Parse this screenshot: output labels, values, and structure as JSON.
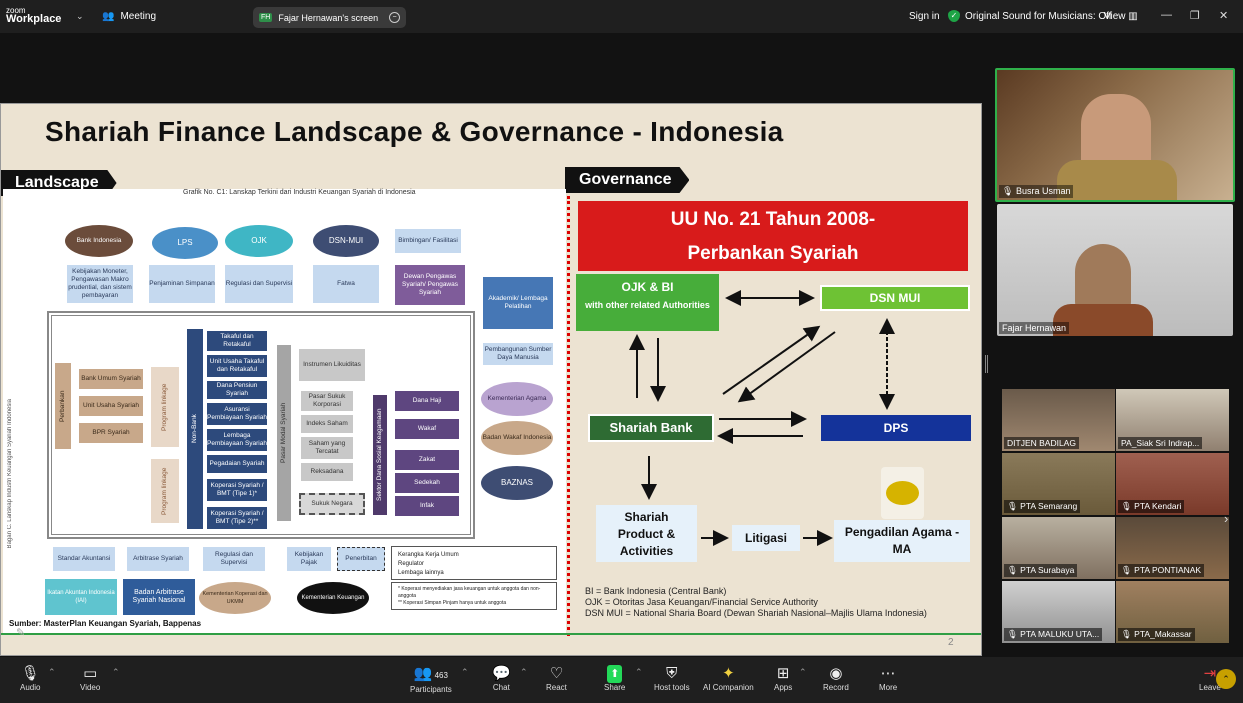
{
  "topbar": {
    "logo_line1": "zoom",
    "logo_line2": "Workplace",
    "meeting_label": "Meeting",
    "screen_share_initials": "FH",
    "screen_share_label": "Fajar Hernawan's screen",
    "sign_in": "Sign in",
    "sound_label": "Original Sound for Musicians: Off",
    "view_label": "View"
  },
  "slide": {
    "title": "Shariah Finance Landscape & Governance - Indonesia",
    "landscape_tag": "Landscape",
    "governance_tag": "Governance",
    "landscape": {
      "caption": "Grafik No. C1: Lanskap Terkini dari Industri Keuangan Syariah di Indonesia",
      "side_label": "Bagan C. Lanskap Industri Keuangan Syariah Indonesia",
      "source": "Sumber: MasterPlan Keuangan Syariah, Bappenas",
      "bank_indonesia": "Bank Indonesia",
      "lps": "LPS",
      "ojk": "OJK",
      "dsn_mui": "DSN-MUI",
      "bimbingan": "Bimbingan/ Fasilitasi",
      "kebijakan_moneter": "Kebijakan Moneter, Pengawasan Makro prudential, dan sistem pembayaran",
      "penjaminan": "Penjaminan Simpanan",
      "regulasi_supervisi": "Regulasi dan Supervisi",
      "fatwa": "Fatwa",
      "dewan_pengawas": "Dewan Pengawas Syariah/ Pengawas Syariah",
      "akademik": "Akademik/ Lembaga Pelatihan",
      "pembangunan_sdm": "Pembangunan Sumber Daya Manusia",
      "kementerian_agama": "Kementerian Agama",
      "badan_wakaf": "Badan Wakaf Indonesia",
      "baznas": "BAZNAS",
      "perbankan": "Perbankan",
      "bank_umum": "Bank Umum Syariah",
      "unit_usaha": "Unit Usaha Syariah",
      "bpr": "BPR Syariah",
      "program_linkage_1": "Program linkage",
      "program_linkage_2": "Program linkage",
      "non_bank": "Non-Bank",
      "takaful": "Takaful dan Retakaful",
      "unit_usaha_takaful": "Unit Usaha Takaful dan Retakaful",
      "dana_pensiun": "Dana Pensiun Syariah",
      "asuransi_pembiayaan": "Asuransi Pembiayaan Syariah",
      "lembaga_pembiayaan": "Lembaga Pembiayaan Syariah",
      "pegadaian": "Pegadaian Syariah",
      "koperasi_1": "Koperasi Syariah / BMT (Tipe 1)*",
      "koperasi_2": "Koperasi Syariah / BMT (Tipe 2)**",
      "pasar_modal": "Pasar Modal Syariah",
      "instrumen": "Instrumen Likuiditas",
      "dana_haji": "Dana Haji",
      "wakaf": "Wakaf",
      "zakat": "Zakat",
      "sedekah": "Sedekah",
      "infak": "Infak",
      "sektor_sosial": "Sektor Dana Sosial Keagamaan",
      "pasar_sukuk": "Pasar Sukuk Korporasi",
      "reksa_syariah": "Indeks Saham",
      "saham": "Saham yang Tercatat",
      "reksadana": "Reksadana",
      "sukuk_negara": "Sukuk Negara",
      "standar_akuntansi": "Standar Akuntansi",
      "arbitrase": "Arbitrase Syariah",
      "regulasi_supervisi_2": "Regulasi dan Supervisi",
      "kebijakan_pajak": "Kebijakan Pajak",
      "penerbitan": "Penerbitan",
      "ikatan_akuntan": "Ikatan Akuntan Indonesia (IAI)",
      "basyarnas": "Badan Arbitrase Syariah Nasional",
      "kemenkop": "Kementerian Koperasi dan UKMM",
      "kemenkeu": "Kementerian Keuangan",
      "legend_1": "Kerangka Kerja Umum",
      "legend_2": "Regulator",
      "legend_3": "Lembaga lainnya",
      "legend_note_1": "* Koperasi menyediakan jasa keuangan untuk anggota dan non-anggota",
      "legend_note_2": "** Koperasi Simpan Pinjam hanya untuk anggota"
    },
    "governance": {
      "uu_line1": "UU No. 21 Tahun 2008-",
      "uu_line2": "Perbankan Syariah",
      "ojk_bi": "OJK & BI",
      "ojk_bi_sub": "with other related Authorities",
      "dsn_mui": "DSN MUI",
      "shariah_bank": "Shariah Bank",
      "dps": "DPS",
      "spa_line1": "Shariah",
      "spa_line2": "Product &",
      "spa_line3": "Activities",
      "litigasi": "Litigasi",
      "pengadilan_line1": "Pengadilan Agama -",
      "pengadilan_line2": "MA",
      "abbrev_1": "BI = Bank Indonesia (Central Bank)",
      "abbrev_2": "OJK = Otoritas Jasa Keuangan/Financial Service Authority",
      "abbrev_3": "DSN MUI = National Sharia Board (Dewan Shariah Nasional–Majlis Ulama Indonesia)"
    },
    "page_number": "2"
  },
  "participants_video": [
    {
      "name": "Busra Usman"
    },
    {
      "name": "Fajar Hernawan"
    }
  ],
  "participant_grid": [
    {
      "name": "DITJEN BADILAG"
    },
    {
      "name": "PA_Siak Sri Indrap..."
    },
    {
      "name": "PTA Semarang"
    },
    {
      "name": "PTA Kendari"
    },
    {
      "name": "PTA Surabaya"
    },
    {
      "name": "PTA PONTIANAK"
    },
    {
      "name": "PTA MALUKU UTA..."
    },
    {
      "name": "PTA_Makassar"
    }
  ],
  "toolbar": {
    "audio": "Audio",
    "video": "Video",
    "participants": "Participants",
    "participant_count": "463",
    "chat": "Chat",
    "react": "React",
    "share": "Share",
    "host_tools": "Host tools",
    "ai_companion": "AI Companion",
    "apps": "Apps",
    "record": "Record",
    "more": "More",
    "leave": "Leave"
  },
  "colors": {
    "share_green": "#23d959",
    "uu_red": "#d81b1b",
    "ojk_green": "#47ad3a",
    "dps_navy": "#14339a"
  }
}
